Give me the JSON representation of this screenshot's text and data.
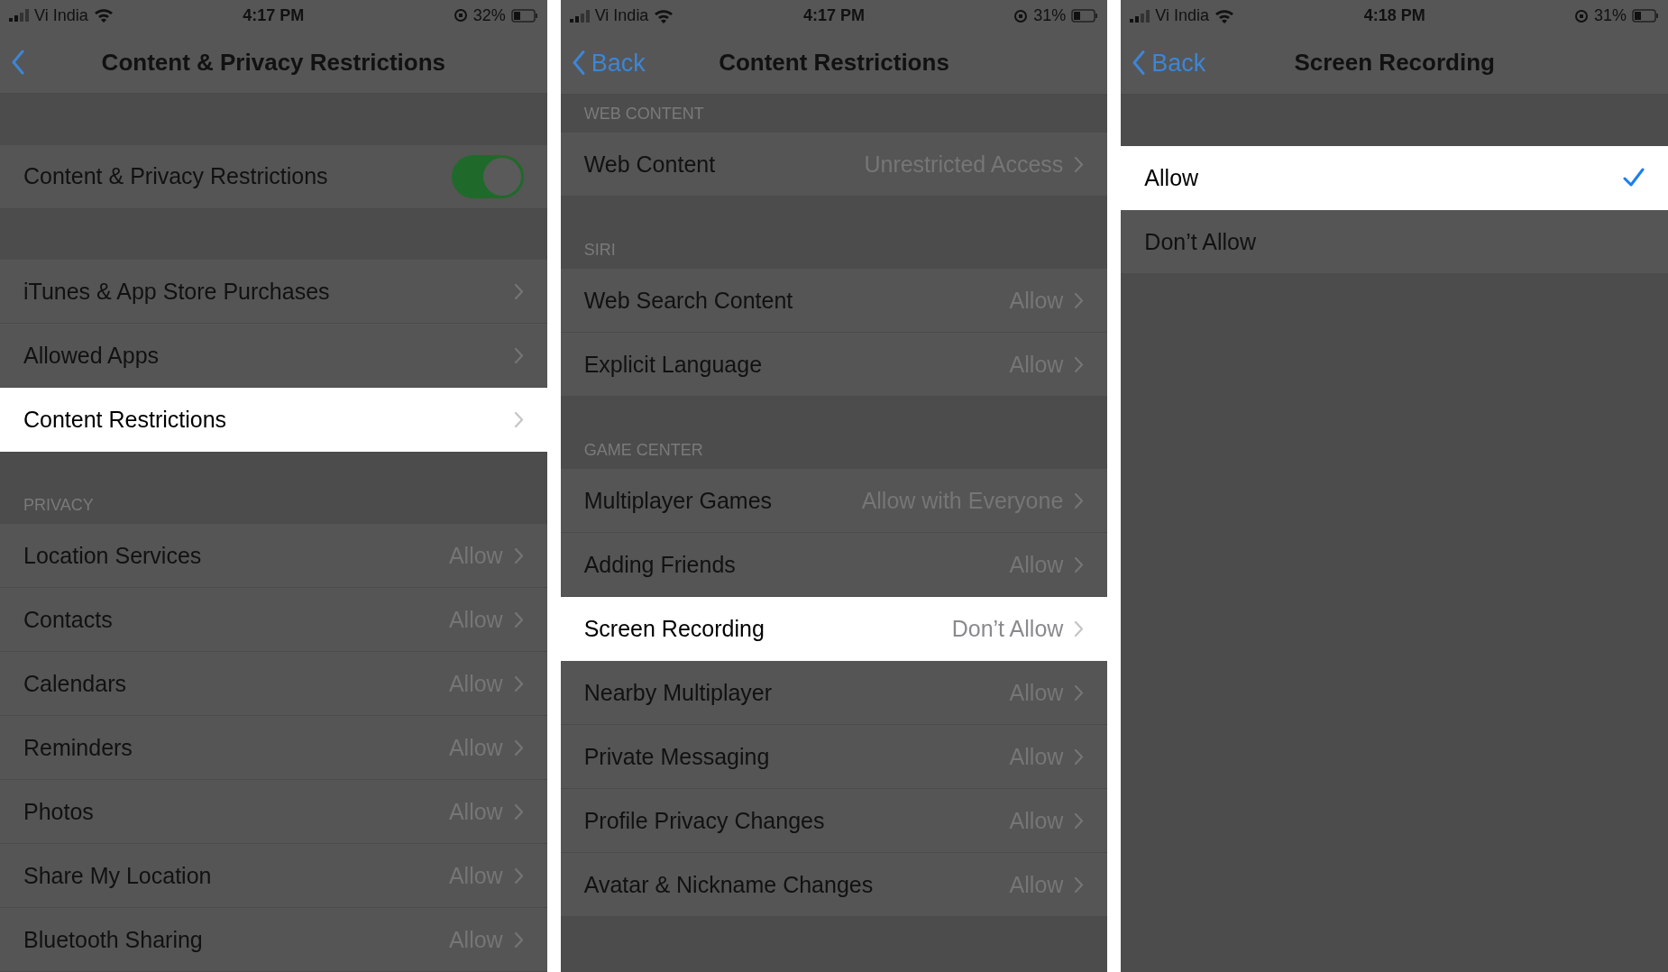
{
  "panels": [
    {
      "status": {
        "carrier": "Vi India",
        "time": "4:17 PM",
        "battery": "32%"
      },
      "nav": {
        "title": "Content & Privacy Restrictions"
      },
      "sections": [
        {
          "rows": [
            {
              "kind": "toggle",
              "label": "Content & Privacy Restrictions",
              "on": true,
              "selected": false
            }
          ]
        },
        {
          "rows": [
            {
              "kind": "link",
              "label": "iTunes & App Store Purchases",
              "selected": false
            },
            {
              "kind": "link",
              "label": "Allowed Apps",
              "selected": false
            },
            {
              "kind": "link",
              "label": "Content Restrictions",
              "selected": true
            }
          ]
        },
        {
          "header": "PRIVACY",
          "rows": [
            {
              "kind": "link",
              "label": "Location Services",
              "value": "Allow",
              "selected": false
            },
            {
              "kind": "link",
              "label": "Contacts",
              "value": "Allow",
              "selected": false
            },
            {
              "kind": "link",
              "label": "Calendars",
              "value": "Allow",
              "selected": false
            },
            {
              "kind": "link",
              "label": "Reminders",
              "value": "Allow",
              "selected": false
            },
            {
              "kind": "link",
              "label": "Photos",
              "value": "Allow",
              "selected": false
            },
            {
              "kind": "link",
              "label": "Share My Location",
              "value": "Allow",
              "selected": false
            },
            {
              "kind": "link",
              "label": "Bluetooth Sharing",
              "value": "Allow",
              "selected": false
            }
          ]
        }
      ]
    },
    {
      "status": {
        "carrier": "Vi India",
        "time": "4:17 PM",
        "battery": "31%"
      },
      "nav": {
        "back_label": "Back",
        "title": "Content Restrictions"
      },
      "sections": [
        {
          "header": "WEB CONTENT",
          "rows": [
            {
              "kind": "link",
              "label": "Web Content",
              "value": "Unrestricted Access",
              "selected": false
            }
          ]
        },
        {
          "header": "SIRI",
          "rows": [
            {
              "kind": "link",
              "label": "Web Search Content",
              "value": "Allow",
              "selected": false
            },
            {
              "kind": "link",
              "label": "Explicit Language",
              "value": "Allow",
              "selected": false
            }
          ]
        },
        {
          "header": "GAME CENTER",
          "rows": [
            {
              "kind": "link",
              "label": "Multiplayer Games",
              "value": "Allow with Everyone",
              "selected": false
            },
            {
              "kind": "link",
              "label": "Adding Friends",
              "value": "Allow",
              "selected": false
            },
            {
              "kind": "link",
              "label": "Screen Recording",
              "value": "Don’t Allow",
              "selected": true
            },
            {
              "kind": "link",
              "label": "Nearby Multiplayer",
              "value": "Allow",
              "selected": false
            },
            {
              "kind": "link",
              "label": "Private Messaging",
              "value": "Allow",
              "selected": false
            },
            {
              "kind": "link",
              "label": "Profile Privacy Changes",
              "value": "Allow",
              "selected": false
            },
            {
              "kind": "link",
              "label": "Avatar & Nickname Changes",
              "value": "Allow",
              "selected": false
            }
          ]
        }
      ]
    },
    {
      "status": {
        "carrier": "Vi India",
        "time": "4:18 PM",
        "battery": "31%"
      },
      "nav": {
        "back_label": "Back",
        "title": "Screen Recording"
      },
      "sections": [
        {
          "rows": [
            {
              "kind": "option",
              "label": "Allow",
              "checked": true,
              "selected": true
            },
            {
              "kind": "option",
              "label": "Don’t Allow",
              "checked": false,
              "selected": false
            }
          ]
        }
      ]
    }
  ]
}
